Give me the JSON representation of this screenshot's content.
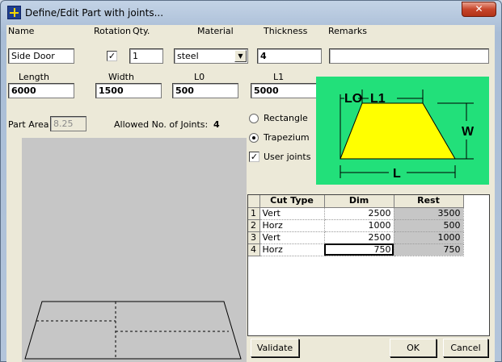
{
  "window": {
    "title": "Define/Edit Part with joints...",
    "close_glyph": "✕"
  },
  "fields": {
    "name_label": "Name",
    "name_value": "Side Door",
    "rotation_label": "Rotation",
    "rotation_checked": "✓",
    "qty_label": "Qty.",
    "qty_value": "1",
    "material_label": "Material",
    "material_value": "steel",
    "thickness_label": "Thickness",
    "thickness_value": "4",
    "remarks_label": "Remarks",
    "remarks_value": "",
    "length_label": "Length",
    "length_value": "6000",
    "width_label": "Width",
    "width_value": "1500",
    "l0_label": "L0",
    "l0_value": "500",
    "l1_label": "L1",
    "l1_value": "5000",
    "part_area_label": "Part Area",
    "part_area_value": "8.25",
    "allowed_joints_label": "Allowed No. of Joints:",
    "allowed_joints_value": "4"
  },
  "shape_options": {
    "rectangle_label": "Rectangle",
    "trapezium_label": "Trapezium",
    "user_joints_label": "User joints",
    "selected": "Trapezium",
    "user_joints_checked": "✓"
  },
  "diagram": {
    "lo_label": "LO",
    "l1_label": "L1",
    "w_label": "W",
    "l_label": "L",
    "bg_color": "#22e07a",
    "shape_color": "#ffff00"
  },
  "joints_table": {
    "headers": [
      "",
      "Cut Type",
      "Dim",
      "Rest"
    ],
    "rows": [
      {
        "num": "1",
        "cut_type": "Vert",
        "dim": "2500",
        "rest": "3500"
      },
      {
        "num": "2",
        "cut_type": "Horz",
        "dim": "1000",
        "rest": "500"
      },
      {
        "num": "3",
        "cut_type": "Vert",
        "dim": "2500",
        "rest": "1000"
      },
      {
        "num": "4",
        "cut_type": "Horz",
        "dim": "750",
        "rest": "750"
      }
    ]
  },
  "buttons": {
    "validate": "Validate",
    "ok": "OK",
    "cancel": "Cancel"
  }
}
